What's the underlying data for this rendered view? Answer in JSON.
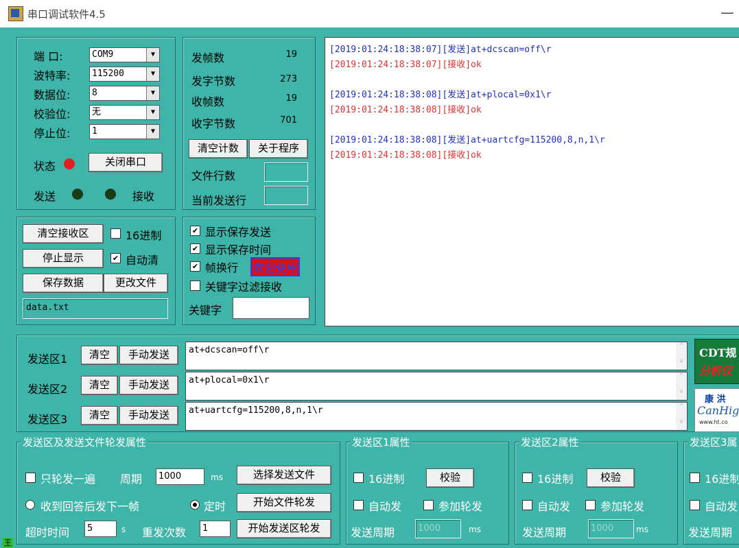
{
  "window": {
    "title": "串口调试软件4.5",
    "minimize": "—"
  },
  "port": {
    "port_label": "端  口:",
    "port_value": "COM9",
    "baud_label": "波特率:",
    "baud_value": "115200",
    "data_label": "数据位:",
    "data_value": "8",
    "parity_label": "校验位:",
    "parity_value": "无",
    "stop_label": "停止位:",
    "stop_value": "1",
    "status_label": "状态",
    "close_button": "关闭串口",
    "send_label": "发送",
    "recv_label": "接收",
    "colors": {
      "status_led": "#e02020",
      "send_led": "#1a3a1a",
      "recv_led": "#1a3a1a"
    }
  },
  "counters": {
    "tx_frames_label": "发帧数",
    "tx_frames": "19",
    "tx_bytes_label": "发字节数",
    "tx_bytes": "273",
    "rx_frames_label": "收帧数",
    "rx_frames": "19",
    "rx_bytes_label": "收字节数",
    "rx_bytes": "701",
    "clear_count": "清空计数",
    "about": "关于程序",
    "file_lines_label": "文件行数",
    "current_line_label": "当前发送行"
  },
  "receive": {
    "clear_button": "清空接收区",
    "hex_label": "16进制",
    "hex_checked": false,
    "stop_display": "停止显示",
    "auto_clear_label": "自动清",
    "auto_clear_checked": true,
    "save_data": "保存数据",
    "change_file": "更改文件",
    "file_name": "data.txt"
  },
  "display_options": {
    "show_save_send": "显示保存发送",
    "show_save_send_checked": true,
    "show_save_time": "显示保存时间",
    "show_save_time_checked": true,
    "frame_newline": "帧换行",
    "frame_newline_checked": true,
    "welcome": "欢迎使用",
    "keyword_filter": "关键字过滤接收",
    "keyword_filter_checked": false,
    "keyword_label": "关键字"
  },
  "log": [
    {
      "time": "[2019:01:24:18:38:07]",
      "tag": "[发送]",
      "text": "at+dcscan=off\\r",
      "color": "#2030c0"
    },
    {
      "time": "[2019:01:24:18:38:07]",
      "tag": "[接收]",
      "text": "ok",
      "color": "#e03030"
    },
    {
      "time": "[2019:01:24:18:38:08]",
      "tag": "[发送]",
      "text": "at+plocal=0x1\\r",
      "color": "#2030c0"
    },
    {
      "time": "[2019:01:24:18:38:08]",
      "tag": "[接收]",
      "text": "ok",
      "color": "#e03030"
    },
    {
      "time": "[2019:01:24:18:38:08]",
      "tag": "[发送]",
      "text": "at+uartcfg=115200,8,n,1\\r",
      "color": "#2030c0"
    },
    {
      "time": "[2019:01:24:18:38:08]",
      "tag": "[接收]",
      "text": "ok",
      "color": "#e03030"
    }
  ],
  "send_areas": [
    {
      "label": "发送区1",
      "clear": "清空",
      "manual": "手动发送",
      "text": "at+dcscan=off\\r"
    },
    {
      "label": "发送区2",
      "clear": "清空",
      "manual": "手动发送",
      "text": "at+plocal=0x1\\r"
    },
    {
      "label": "发送区3",
      "clear": "清空",
      "manual": "手动发送",
      "text": "at+uartcfg=115200,8,n,1\\r"
    }
  ],
  "ads": {
    "cdt_line1": "CDT规",
    "cdt_line2": "分析仪",
    "kang": "康 洪",
    "canhig": "CanHig",
    "url": "www.ht.co"
  },
  "rotation": {
    "group_title": "发送区及发送文件轮发属性",
    "once_label": "只轮发一遍",
    "once_checked": false,
    "period_label": "周期",
    "period_value": "1000",
    "period_unit": "ms",
    "select_file": "选择发送文件",
    "reply_next": "收到回答后发下一帧",
    "reply_next_selected": false,
    "timed": "定时",
    "timed_selected": true,
    "start_file": "开始文件轮发",
    "timeout_label": "超时时间",
    "timeout_value": "5",
    "timeout_unit": "s",
    "retry_label": "重发次数",
    "retry_value": "1",
    "start_area": "开始发送区轮发"
  },
  "area_props": [
    {
      "title": "发送区1属性",
      "hex": "16进制",
      "check": "校验",
      "auto": "自动发",
      "join": "参加轮发",
      "period_label": "发送周期",
      "period_value": "1000",
      "unit": "ms"
    },
    {
      "title": "发送区2属性",
      "hex": "16进制",
      "check": "校验",
      "auto": "自动发",
      "join": "参加轮发",
      "period_label": "发送周期",
      "period_value": "1000",
      "unit": "ms"
    },
    {
      "title": "发送区3属",
      "hex": "16进制",
      "auto": "自动发",
      "period_label": "发送周期"
    }
  ],
  "bottom_marker": "王"
}
